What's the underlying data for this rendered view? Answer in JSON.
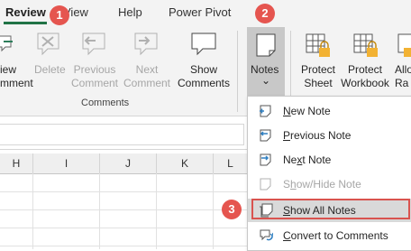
{
  "ribbon_tabs": [
    "Review",
    "View",
    "Help",
    "Power Pivot"
  ],
  "ribbon_buttons": {
    "new_comment": [
      "iew",
      "mment"
    ],
    "delete": [
      "Delete"
    ],
    "previous_comment": [
      "Previous",
      "Comment"
    ],
    "next_comment": [
      "Next",
      "Comment"
    ],
    "show_comments": [
      "Show",
      "Comments"
    ],
    "notes": "Notes",
    "notes_arrow": "⌄",
    "protect_sheet": [
      "Protect",
      "Sheet"
    ],
    "protect_workbook": [
      "Protect",
      "Workbook"
    ],
    "allow_ranges": [
      "Allo",
      "Ra"
    ]
  },
  "group_label": "Comments",
  "columns": [
    "H",
    "I",
    "J",
    "K",
    "L"
  ],
  "notes_menu": [
    {
      "label": "New Note",
      "underline": "N",
      "rest": "ew Note",
      "disabled": false
    },
    {
      "label": "Previous Note",
      "underline": "P",
      "rest": "revious Note",
      "disabled": false
    },
    {
      "label": "Next Note",
      "pre": "Ne",
      "underline": "x",
      "rest": "t Note",
      "disabled": false
    },
    {
      "label": "Show/Hide Note",
      "pre": "S",
      "underline": "h",
      "rest": "ow/Hide Note",
      "disabled": true
    },
    {
      "label": "Show All Notes",
      "pre": "",
      "underline": "S",
      "rest": "how All Notes",
      "disabled": false,
      "highlighted": true
    },
    {
      "label": "Convert to Comments",
      "underline": "C",
      "rest": "onvert to Comments",
      "disabled": false
    }
  ],
  "steps": [
    "1",
    "2",
    "3"
  ],
  "colors": {
    "accent": "#217346",
    "badge": "#e5554f",
    "highlight_border": "#d9534f"
  }
}
